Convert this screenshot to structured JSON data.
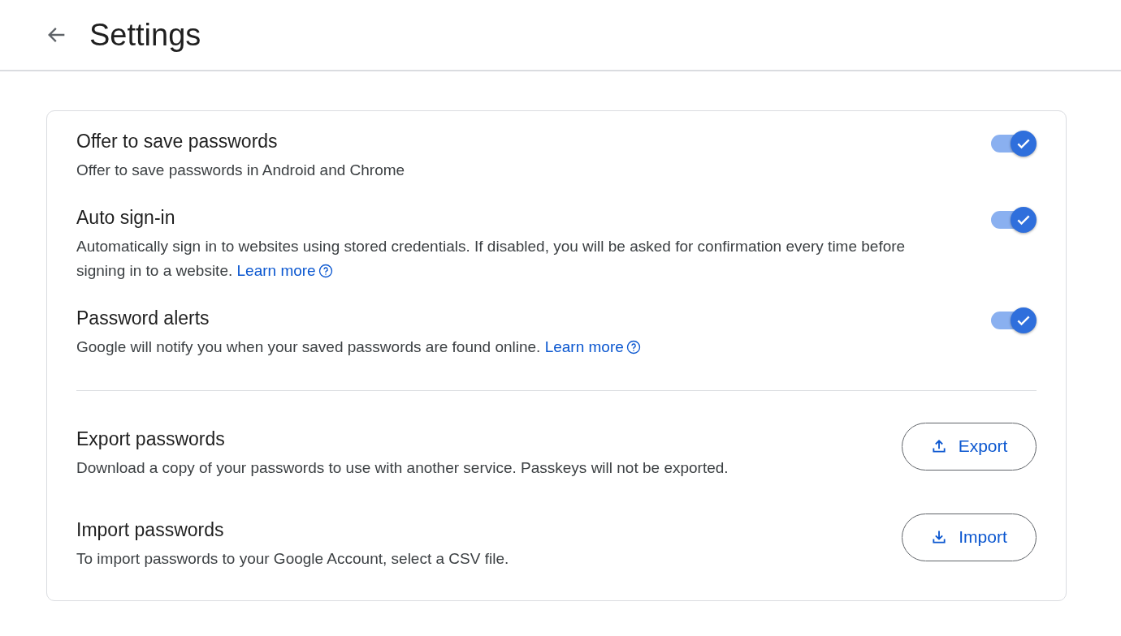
{
  "header": {
    "title": "Settings"
  },
  "toggle_rows": [
    {
      "title": "Offer to save passwords",
      "description": "Offer to save passwords in Android and Chrome",
      "on": true
    },
    {
      "title": "Auto sign-in",
      "description": "Automatically sign in to websites using stored credentials. If disabled, you will be asked for confirmation every time before signing in to a website.",
      "link": "Learn more",
      "on": true
    },
    {
      "title": "Password alerts",
      "description": "Google will notify you when your saved passwords are found online.",
      "link": "Learn more",
      "on": true
    }
  ],
  "action_rows": [
    {
      "title": "Export passwords",
      "description": "Download a copy of your passwords to use with another service. Passkeys will not be exported.",
      "button": "Export",
      "kind": "export"
    },
    {
      "title": "Import passwords",
      "description": "To import passwords to your Google Account, select a CSV file.",
      "button": "Import",
      "kind": "import"
    }
  ]
}
